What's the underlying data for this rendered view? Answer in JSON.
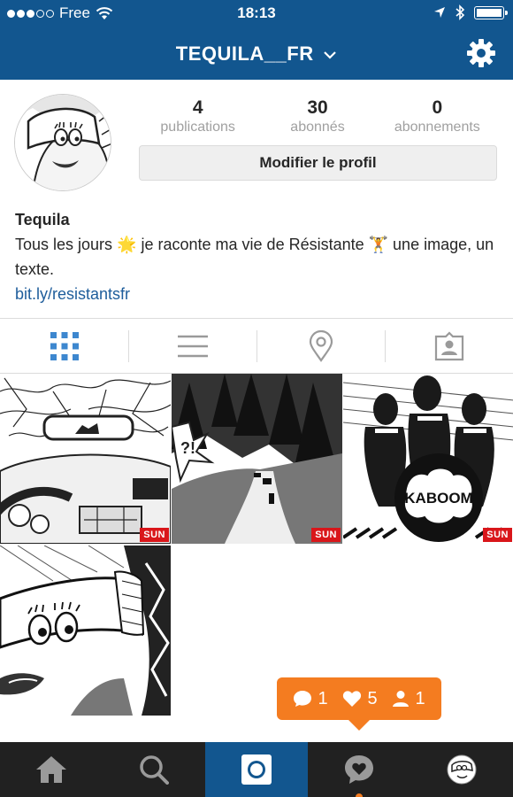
{
  "status_bar": {
    "carrier": "Free",
    "time": "18:13"
  },
  "header": {
    "username": "TEQUILA__FR",
    "dropdown_icon": "chevron-down-icon",
    "settings_icon": "gear-icon"
  },
  "profile": {
    "stats": [
      {
        "value": "4",
        "label": "publications"
      },
      {
        "value": "30",
        "label": "abonnés"
      },
      {
        "value": "0",
        "label": "abonnements"
      }
    ],
    "edit_button": "Modifier le profil",
    "name": "Tequila",
    "bio_part1": "Tous les jours ",
    "bio_emoji1": "🌟",
    "bio_part2": " je raconte ma vie de Résistante ",
    "bio_emoji2": "🏋",
    "bio_part3": " une image, un texte.",
    "link": "bit.ly/resistantsfr"
  },
  "tabs": [
    {
      "name": "grid-view",
      "icon": "grid-icon",
      "active": true
    },
    {
      "name": "list-view",
      "icon": "list-icon",
      "active": false
    },
    {
      "name": "map-view",
      "icon": "location-pin-icon",
      "active": false
    },
    {
      "name": "tagged-view",
      "icon": "tagged-person-icon",
      "active": false
    }
  ],
  "posts": [
    {
      "badge": "SUN",
      "subject": "car interior with mirror"
    },
    {
      "badge": "SUN",
      "subject": "mountain road with cars"
    },
    {
      "badge": "SUN",
      "subject": "bowling pins kaboom"
    },
    {
      "badge": "",
      "subject": "girl face with hand"
    }
  ],
  "post3_text": "KABOOM",
  "notification": {
    "comments": "1",
    "likes": "5",
    "followers": "1"
  },
  "colors": {
    "brand_blue": "#12568f",
    "notif_orange": "#f47c20",
    "link_blue": "#1e5d9b",
    "badge_red": "#d9161a"
  }
}
